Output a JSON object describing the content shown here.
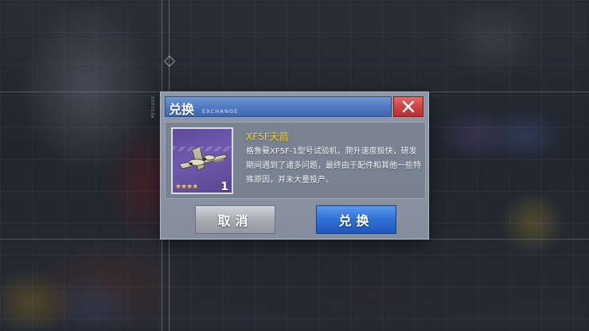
{
  "dialog": {
    "title": "兑换",
    "title_en": "EXCHANGE",
    "close_icon": "close-x-icon",
    "item": {
      "name": "XF5F天箭",
      "description": "格鲁曼XF5F-1型号试验机，爬升速度极快，研发期间遇到了诸多问题，最终由于配件和其他一些特殊原因，并未大量投产。",
      "rarity_stars": "★★★★",
      "quantity": "1",
      "icon": "fighter-plane-icon",
      "card_color": "#6a55a6"
    },
    "cancel_label": "取消",
    "confirm_label": "兑换"
  },
  "background": {
    "side_tag": "MESSAGE"
  },
  "colors": {
    "title_bar": "#4f79c0",
    "close_button": "#cc4040",
    "item_name": "#f2d12c",
    "confirm_button": "#2f6fd4",
    "cancel_button": "#a8adb4"
  }
}
